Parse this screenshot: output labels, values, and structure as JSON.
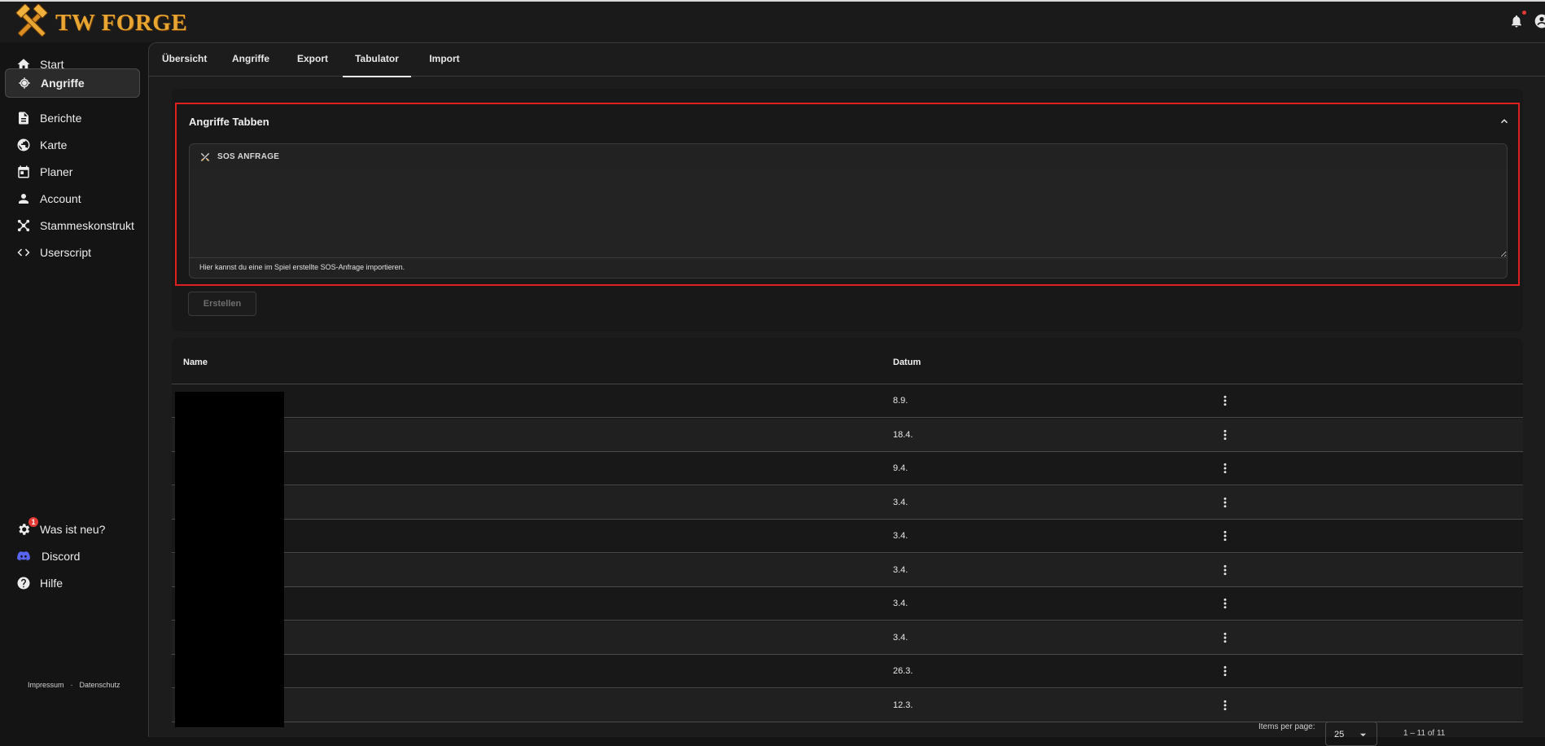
{
  "app": {
    "logo_text": "TW FORGE",
    "accent_color": "#e8a531",
    "highlight_color": "#e0201f"
  },
  "sidebar": {
    "items": [
      {
        "label": "Start",
        "icon": "home-icon",
        "active": false
      },
      {
        "label": "Angriffe",
        "icon": "crosshair-icon",
        "active": true
      },
      {
        "label": "Berichte",
        "icon": "document-icon",
        "active": false
      },
      {
        "label": "Karte",
        "icon": "globe-icon",
        "active": false
      },
      {
        "label": "Planer",
        "icon": "calendar-icon",
        "active": false
      },
      {
        "label": "Account",
        "icon": "person-icon",
        "active": false
      },
      {
        "label": "Stammeskonstrukt",
        "icon": "network-icon",
        "active": false
      },
      {
        "label": "Userscript",
        "icon": "code-icon",
        "active": false
      }
    ],
    "bottom_items": [
      {
        "label": "Was ist neu?",
        "icon": "gear-icon",
        "badge": "1"
      },
      {
        "label": "Discord",
        "icon": "discord-icon"
      },
      {
        "label": "Hilfe",
        "icon": "help-icon"
      }
    ],
    "footer": {
      "impressum": "Impressum",
      "separator": "·",
      "datenschutz": "Datenschutz"
    }
  },
  "tabs": [
    {
      "label": "Übersicht",
      "active": false
    },
    {
      "label": "Angriffe",
      "active": false
    },
    {
      "label": "Export",
      "active": false
    },
    {
      "label": "Tabulator",
      "active": true
    },
    {
      "label": "Import",
      "active": false
    }
  ],
  "panel": {
    "title": "Angriffe Tabben",
    "sos_label": "SOS ANFRAGE",
    "sos_value": "",
    "sos_hint": "Hier kannst du eine im Spiel erstellte SOS-Anfrage importieren.",
    "create_button": "Erstellen"
  },
  "table": {
    "columns": [
      "Name",
      "Datum"
    ],
    "rows": [
      {
        "date": "8.9."
      },
      {
        "date": "18.4."
      },
      {
        "date": "9.4."
      },
      {
        "date": "3.4."
      },
      {
        "date": "3.4."
      },
      {
        "date": "3.4."
      },
      {
        "date": "3.4."
      },
      {
        "date": "3.4."
      },
      {
        "date": "26.3."
      },
      {
        "date": "12.3."
      }
    ]
  },
  "paginator": {
    "items_per_page_label": "Items per page:",
    "items_per_page": "25",
    "range": "1 – 11 of 11"
  }
}
